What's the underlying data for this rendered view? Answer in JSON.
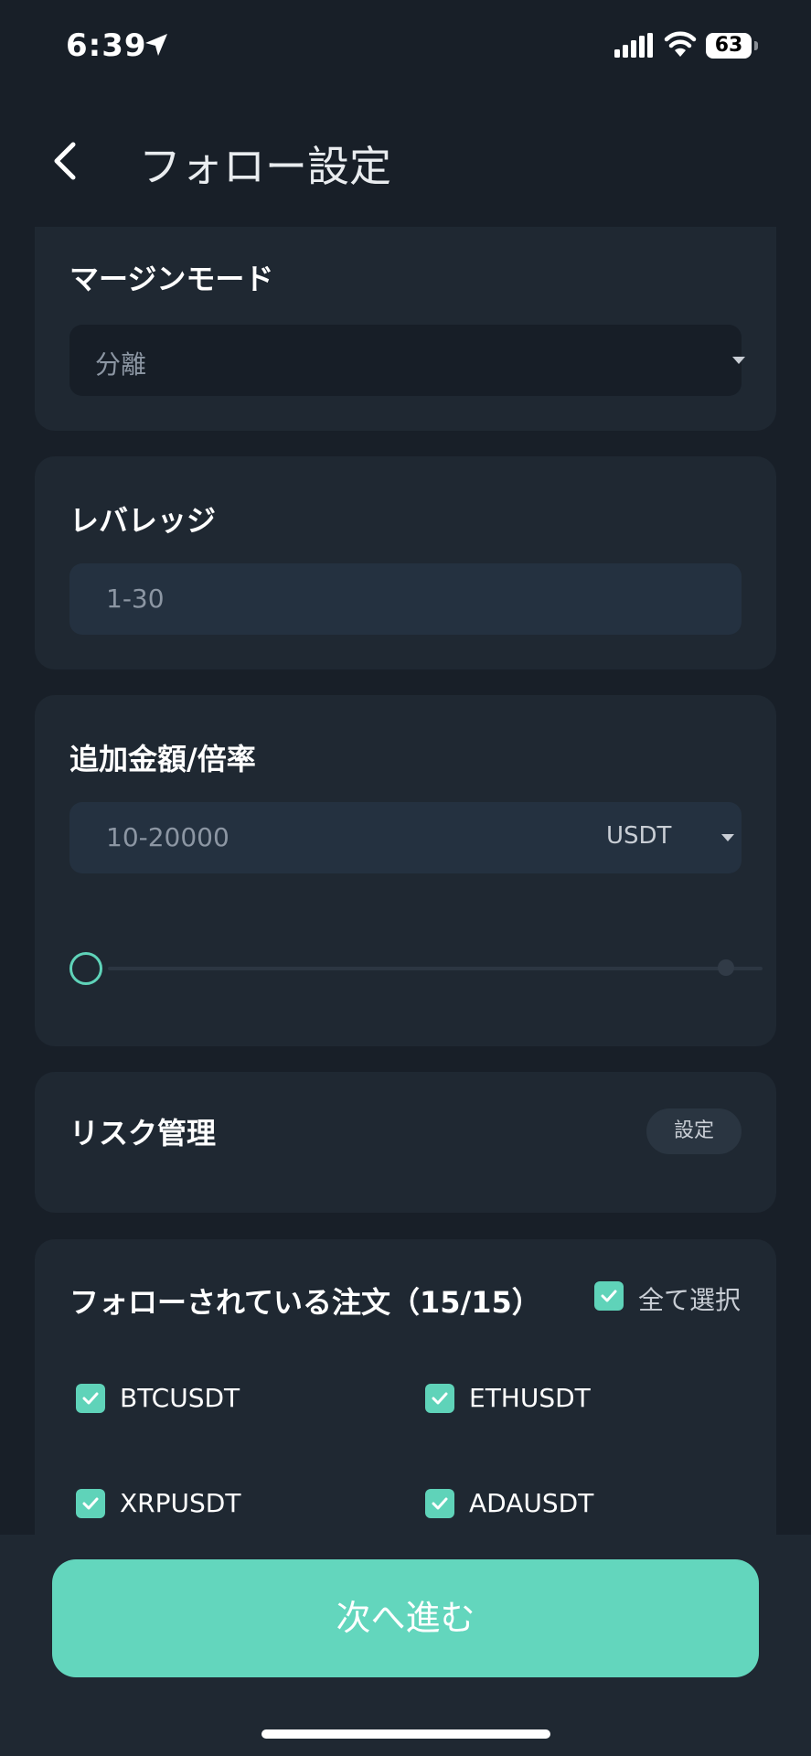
{
  "status_bar": {
    "time": "6:39",
    "battery": "63"
  },
  "header": {
    "title": "フォロー設定"
  },
  "margin_mode": {
    "title": "マージンモード",
    "value": "分離"
  },
  "leverage": {
    "title": "レバレッジ",
    "placeholder": "1-30"
  },
  "amount": {
    "title": "追加金額/倍率",
    "placeholder": "10-20000",
    "unit": "USDT",
    "slider_value": 0
  },
  "risk": {
    "title": "リスク管理",
    "button": "設定"
  },
  "orders": {
    "title": "フォローされている注文（15/15）",
    "select_all": "全て選択",
    "select_all_checked": true,
    "pairs": [
      {
        "label": "BTCUSDT",
        "checked": true
      },
      {
        "label": "ETHUSDT",
        "checked": true
      },
      {
        "label": "XRPUSDT",
        "checked": true
      },
      {
        "label": "ADAUSDT",
        "checked": true
      }
    ]
  },
  "footer": {
    "next_label": "次へ進む"
  },
  "colors": {
    "background": "#181f28",
    "card": "#1f2832",
    "accent": "#63d6bd",
    "input": "#243140"
  },
  "icons": [
    "location-arrow-icon",
    "signal-icon",
    "wifi-icon",
    "battery-icon",
    "back-chevron-icon",
    "caret-down-icon",
    "checkmark-icon"
  ]
}
